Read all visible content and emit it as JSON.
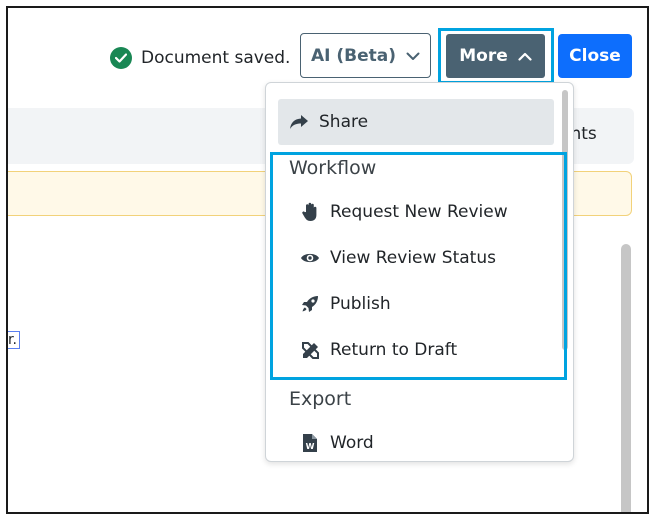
{
  "header": {
    "status_text": "Document saved.",
    "ai_button_label": "AI (Beta)",
    "more_button_label": "More",
    "close_button_label": "Close"
  },
  "background": {
    "tab_fragment": "ents",
    "text_fragment": "r."
  },
  "menu": {
    "share_label": "Share",
    "workflow_heading": "Workflow",
    "workflow_items": [
      {
        "label": "Request New Review",
        "icon": "hand-icon"
      },
      {
        "label": "View Review Status",
        "icon": "eye-icon"
      },
      {
        "label": "Publish",
        "icon": "rocket-icon"
      },
      {
        "label": "Return to Draft",
        "icon": "pencil-ruler-icon"
      }
    ],
    "export_heading": "Export",
    "export_items": [
      {
        "label": "Word",
        "icon": "word-file-icon"
      }
    ]
  },
  "colors": {
    "accent_highlight": "#00a3e0",
    "more_button_bg": "#4a6272",
    "close_button_bg": "#0d6efd",
    "success_green": "#198754"
  }
}
